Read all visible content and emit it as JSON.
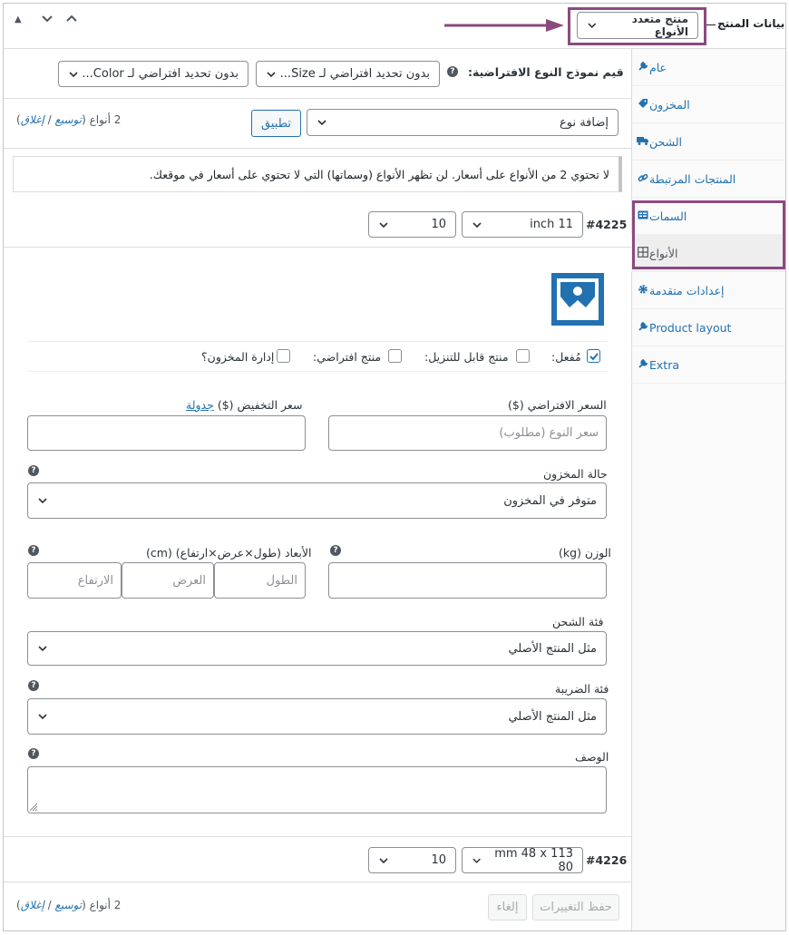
{
  "header": {
    "title": "بيانات المنتج",
    "product_type": "منتج متعدد الأنواع",
    "up_arrow": "▲",
    "chev_down": "⌄",
    "chev_up": "⌃"
  },
  "tabs": [
    {
      "label": "عام",
      "icon": "wrench-icon",
      "glyph": "🔧"
    },
    {
      "label": "المخزون",
      "icon": "tag-icon",
      "glyph": "◈"
    },
    {
      "label": "الشحن",
      "icon": "truck-icon",
      "glyph": "🚚"
    },
    {
      "label": "المنتجات المرتبطة",
      "icon": "link-icon",
      "glyph": "🔗"
    },
    {
      "label": "السمات",
      "icon": "list-icon",
      "glyph": "▤"
    },
    {
      "label": "الأنواع",
      "icon": "grid-icon",
      "glyph": "⊞"
    },
    {
      "label": "إعدادات متقدمة",
      "icon": "gear-icon",
      "glyph": "⚙"
    },
    {
      "label": "Product layout",
      "icon": "wrench-icon",
      "glyph": "🔧"
    },
    {
      "label": "Extra",
      "icon": "wrench-icon",
      "glyph": "🔧"
    }
  ],
  "defaults": {
    "label": "قيم نموذج النوع الافتراضية:",
    "size_select": "بدون تحديد افتراضي لـ Size...",
    "color_select": "بدون تحديد افتراضي لـ Color..."
  },
  "actions": {
    "add_variation": "إضافة نوع",
    "apply": "تطبيق",
    "count_label": "2 أنواع",
    "expand": "توسيع",
    "sep": "/",
    "collapse": "إغلاق"
  },
  "notice": "لا تحتوي 2 من الأنواع على أسعار. لن تظهر الأنواع (وسماتها) التي لا تحتوي على أسعار في موقعك.",
  "variation1": {
    "id": "#4225",
    "attr1": "inch 11",
    "attr2": "10",
    "enabled": "مُفعل:",
    "downloadable": "منتج قابل للتنزيل:",
    "virtual": "منتج افتراضي:",
    "manage_stock": "إدارة المخزون؟",
    "regular_price_label": "السعر الافتراضي ($)",
    "regular_price_placeholder": "سعر النوع (مطلوب)",
    "sale_price_label": "سعر التخفيض ($)",
    "schedule": "جدولة",
    "stock_status_label": "حالة المخزون",
    "stock_status": "متوفر في المخزون",
    "weight_label": "الوزن (kg)",
    "dimensions_label": "الأبعاد (طول×عرض×ارتفاع) (cm)",
    "length_ph": "الطول",
    "width_ph": "العرض",
    "height_ph": "الارتفاع",
    "shipping_class_label": "فئة الشحن",
    "shipping_class": "مثل المنتج الأصلي",
    "tax_class_label": "فئة الضريبة",
    "tax_class": "مثل المنتج الأصلي",
    "description_label": "الوصف"
  },
  "variation2": {
    "id": "#4226",
    "attr1": "113 mm 48 x 80",
    "attr2": "10"
  },
  "footer": {
    "save": "حفظ التغييرات",
    "cancel": "إلغاء"
  },
  "colors": {
    "accent": "#2271b1",
    "highlight": "#8b4a7f"
  }
}
